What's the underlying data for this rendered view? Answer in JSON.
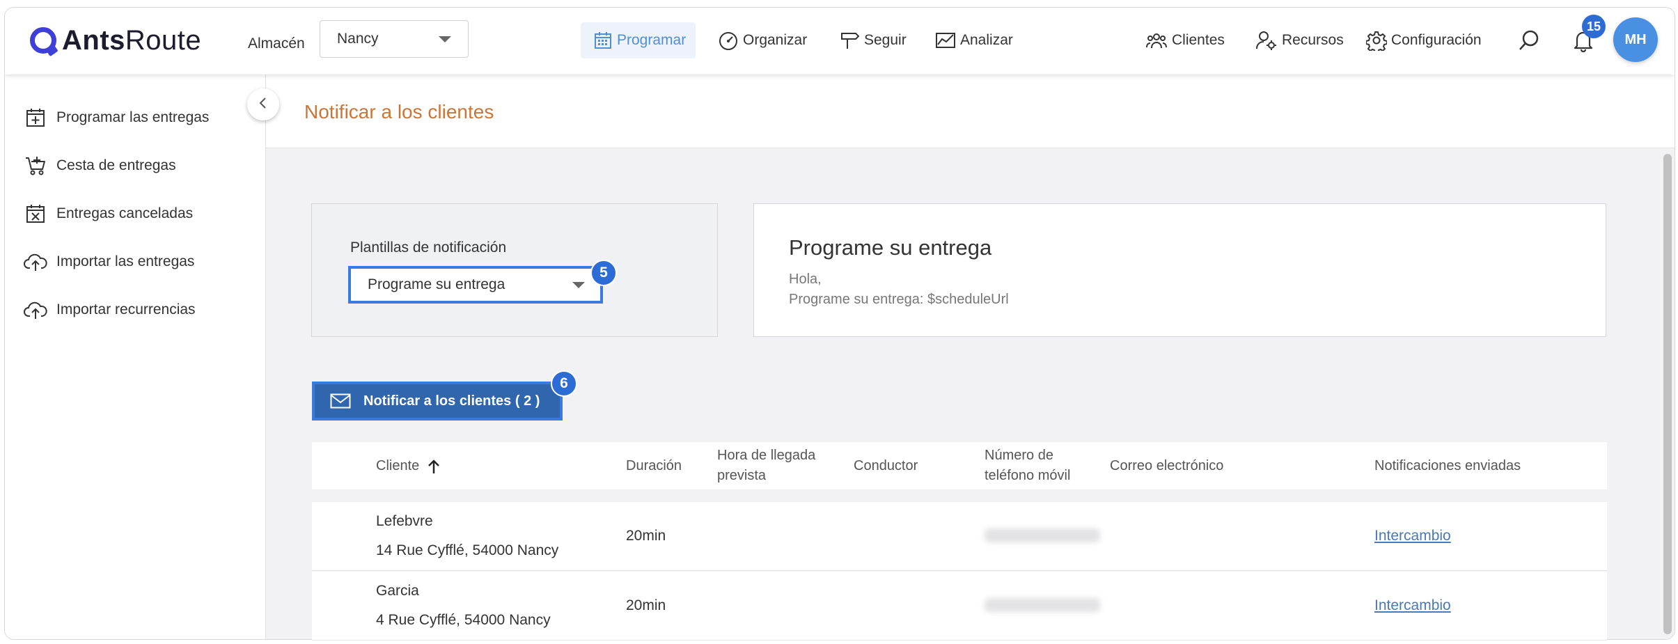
{
  "app": {
    "logo_bold": "Ants",
    "logo_light": "Route"
  },
  "warehouse": {
    "label": "Almacén",
    "value": "Nancy"
  },
  "nav": [
    {
      "label": "Programar",
      "icon": "calendar-icon",
      "active": true
    },
    {
      "label": "Organizar",
      "icon": "speedometer-icon"
    },
    {
      "label": "Seguir",
      "icon": "signpost-icon"
    },
    {
      "label": "Analizar",
      "icon": "chart-icon"
    }
  ],
  "nav_right": [
    {
      "label": "Clientes",
      "icon": "people-icon"
    },
    {
      "label": "Recursos",
      "icon": "resources-icon"
    },
    {
      "label": "Configuración",
      "icon": "gear-icon"
    }
  ],
  "notifications": {
    "count": "15"
  },
  "user": {
    "initials": "MH"
  },
  "sidebar": {
    "items": [
      {
        "label": "Programar las entregas",
        "icon": "calendar-plus-icon"
      },
      {
        "label": "Cesta de entregas",
        "icon": "basket-icon"
      },
      {
        "label": "Entregas canceladas",
        "icon": "calendar-x-icon"
      },
      {
        "label": "Importar las entregas",
        "icon": "cloud-upload-icon"
      },
      {
        "label": "Importar recurrencias",
        "icon": "cloud-upload-icon"
      }
    ]
  },
  "page": {
    "title": "Notificar a los clientes"
  },
  "templates": {
    "label": "Plantillas de notificación",
    "selected": "Programe su entrega",
    "step": "5"
  },
  "preview": {
    "title": "Programe su entrega",
    "line1": "Hola,",
    "line2": "Programe su entrega: $scheduleUrl"
  },
  "notify": {
    "label": "Notificar a los clientes ( 2 )",
    "step": "6"
  },
  "table": {
    "headers": {
      "cliente": "Cliente",
      "duracion": "Duración",
      "hora_1": "Hora de llegada",
      "hora_2": "prevista",
      "conductor": "Conductor",
      "telefono_1": "Número de",
      "telefono_2": "teléfono móvil",
      "correo": "Correo electrónico",
      "notificaciones": "Notificaciones enviadas"
    },
    "rows": [
      {
        "name": "Lefebvre",
        "address": "14 Rue Cyfflé, 54000 Nancy",
        "duration": "20min",
        "notification": "Intercambio"
      },
      {
        "name": "Garcia",
        "address": "4 Rue Cyfflé, 54000 Nancy",
        "duration": "20min",
        "notification": "Intercambio"
      }
    ]
  }
}
